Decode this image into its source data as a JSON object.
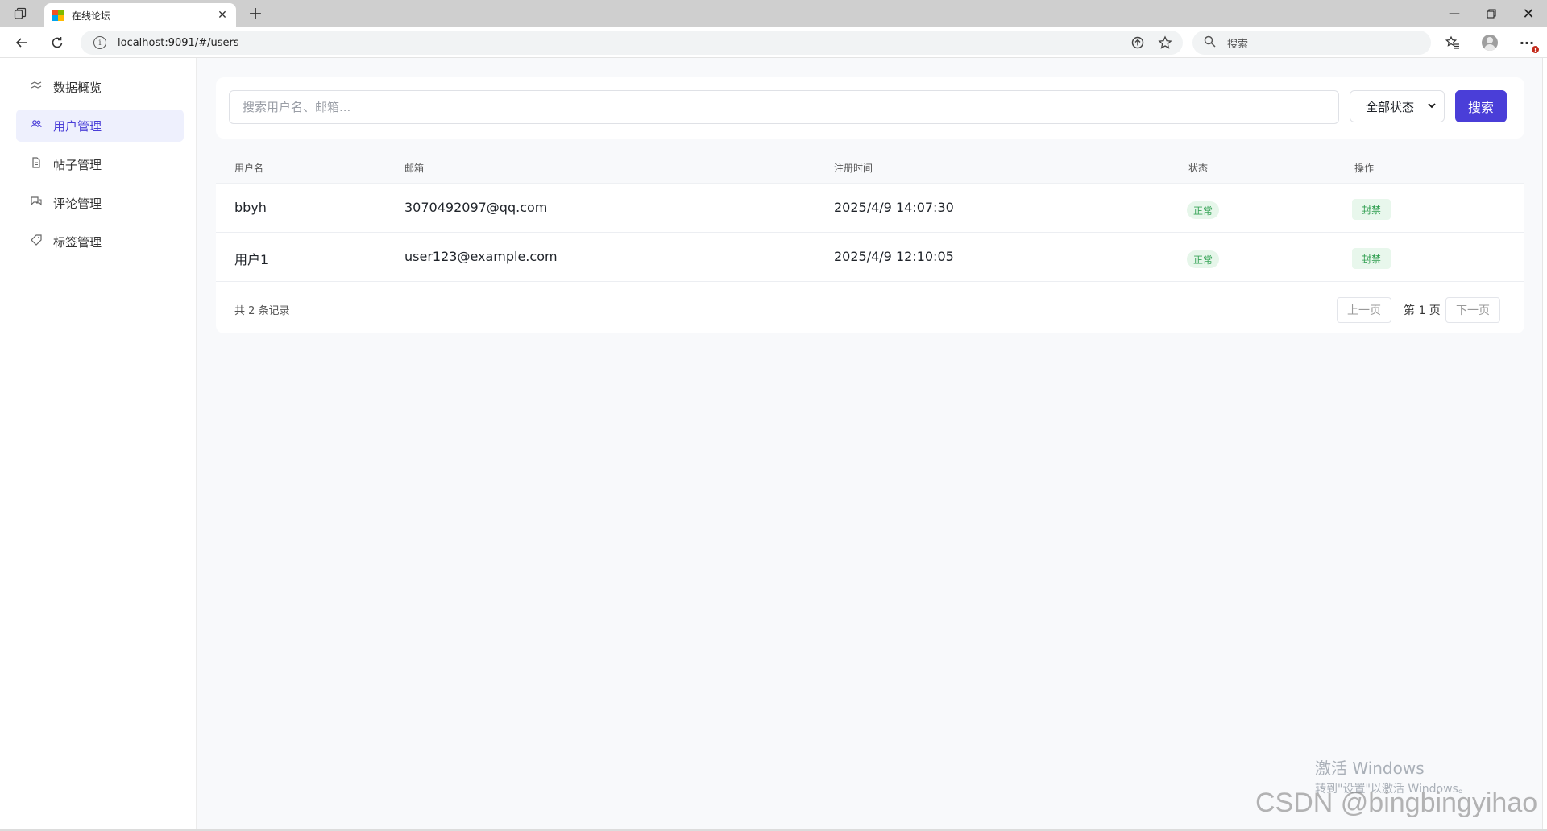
{
  "browser": {
    "tab_title": "在线论坛",
    "url": "localhost:9091/#/users",
    "search_placeholder": "搜索",
    "new_tab_label": "+"
  },
  "sidebar": {
    "items": [
      {
        "label": "数据概览",
        "icon": "chart-icon",
        "active": false
      },
      {
        "label": "用户管理",
        "icon": "users-icon",
        "active": true
      },
      {
        "label": "帖子管理",
        "icon": "document-icon",
        "active": false
      },
      {
        "label": "评论管理",
        "icon": "comment-icon",
        "active": false
      },
      {
        "label": "标签管理",
        "icon": "tag-icon",
        "active": false
      }
    ]
  },
  "filter": {
    "search_placeholder": "搜索用户名、邮箱...",
    "status_selected": "全部状态",
    "search_button": "搜索"
  },
  "table": {
    "headers": [
      "用户名",
      "邮箱",
      "注册时间",
      "状态",
      "操作"
    ],
    "rows": [
      {
        "username": "bbyh",
        "email": "3070492097@qq.com",
        "registered": "2025/4/9 14:07:30",
        "status": "正常",
        "action": "封禁"
      },
      {
        "username": "用户1",
        "email": "user123@example.com",
        "registered": "2025/4/9 12:10:05",
        "status": "正常",
        "action": "封禁"
      }
    ],
    "total_text": "共 2 条记录",
    "prev": "上一页",
    "current_page": "第 1 页",
    "next": "下一页"
  },
  "overlay": {
    "activate_title": "激活 Windows",
    "activate_sub": "转到\"设置\"以激活 Windows。",
    "csdn_watermark": "CSDN @bingbingyihao"
  },
  "colors": {
    "accent": "#4a3ed8",
    "status_green": "#3aa55a",
    "badge_bg": "#e6f6ea"
  }
}
